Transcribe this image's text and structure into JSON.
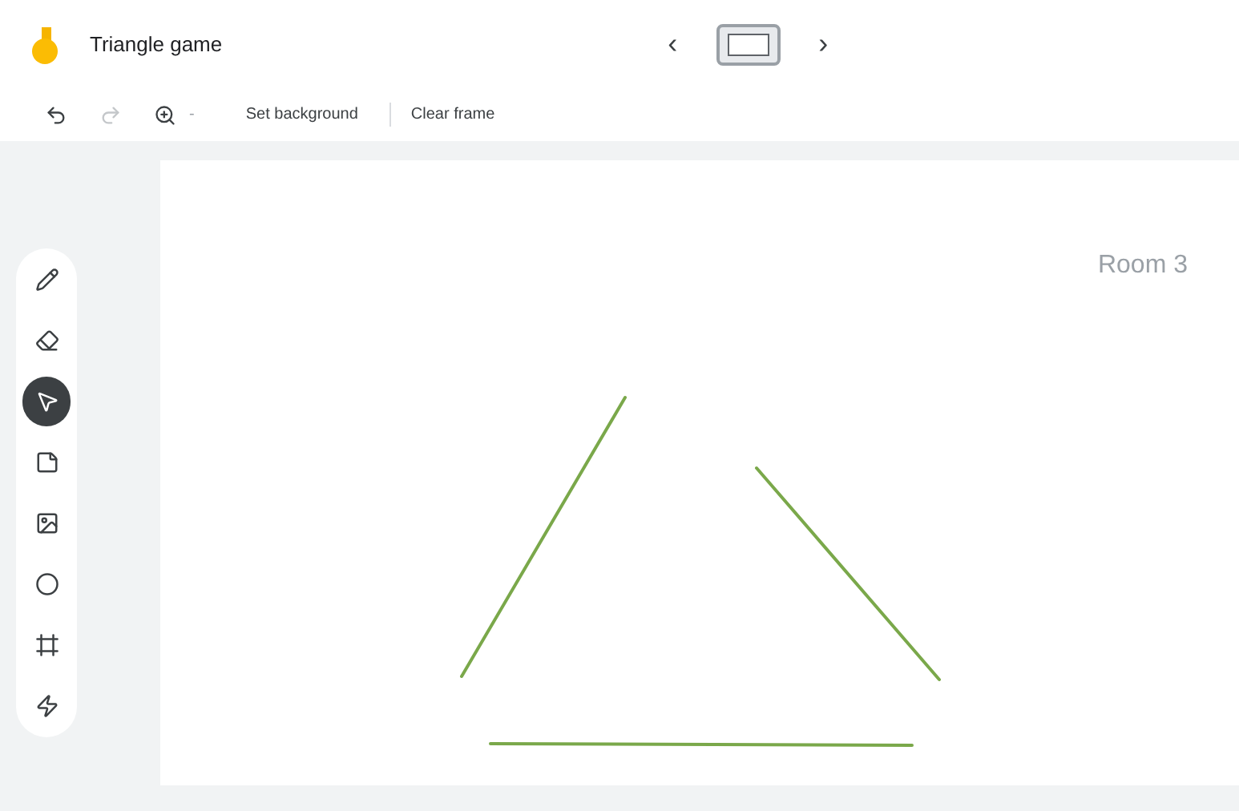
{
  "header": {
    "title": "Triangle game",
    "prev_label": "‹",
    "next_label": "›"
  },
  "toolbar": {
    "zoom_caret": "-",
    "actions": [
      "Set background",
      "Clear frame"
    ],
    "redo_disabled": true
  },
  "tools": [
    {
      "kind": "pen",
      "selected": false
    },
    {
      "kind": "eraser",
      "selected": false
    },
    {
      "kind": "select",
      "selected": true
    },
    {
      "kind": "note",
      "selected": false
    },
    {
      "kind": "image",
      "selected": false
    },
    {
      "kind": "shape",
      "selected": false
    },
    {
      "kind": "frame",
      "selected": false
    },
    {
      "kind": "laser",
      "selected": false
    }
  ],
  "canvas": {
    "label": "Room 3"
  }
}
